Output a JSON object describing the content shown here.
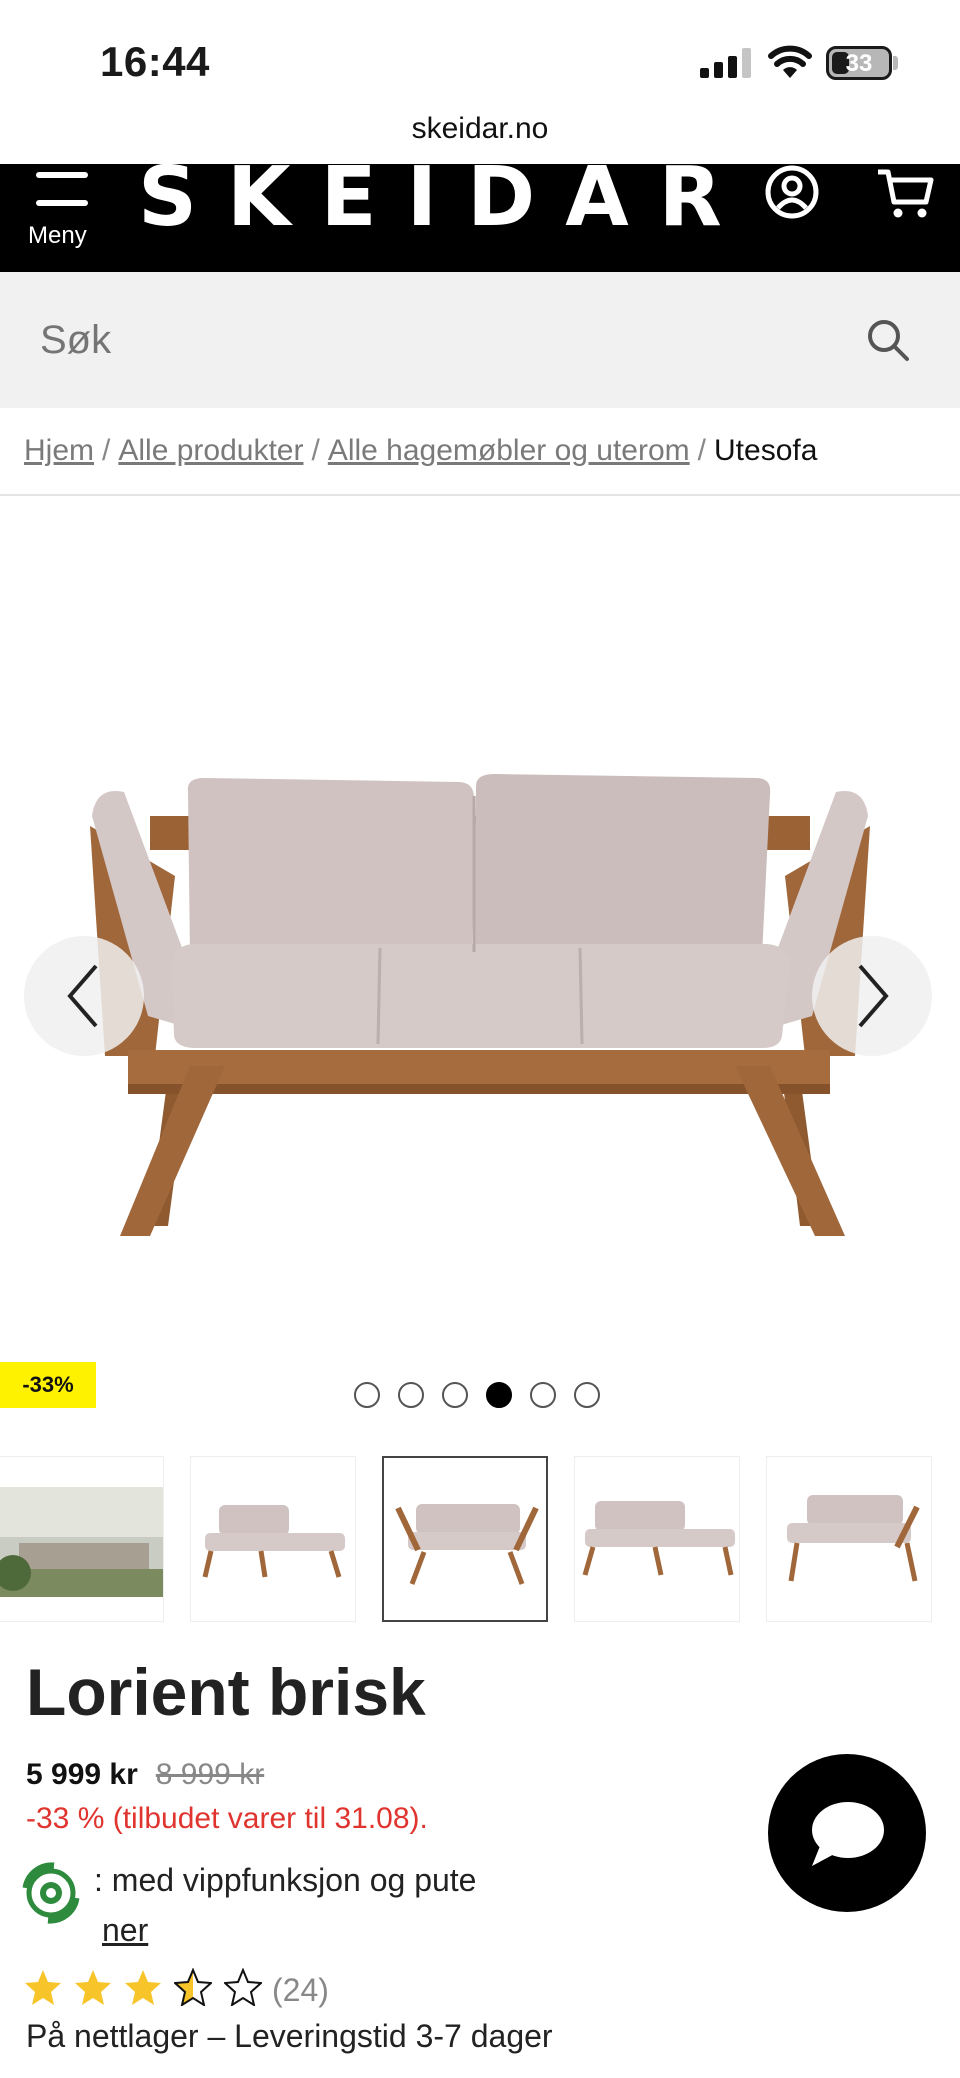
{
  "status_bar": {
    "time": "16:44",
    "battery": "33"
  },
  "browser": {
    "url": "skeidar.no"
  },
  "header": {
    "menu_label": "Meny",
    "logo": "SKEIDAR"
  },
  "search": {
    "placeholder": "Søk"
  },
  "breadcrumb": {
    "items": [
      "Hjem",
      "Alle produkter",
      "Alle hagemøbler og uterom"
    ],
    "current": "Utesofa"
  },
  "gallery": {
    "discount_badge": "-33%",
    "total_dots": 6,
    "active_dot": 4
  },
  "product": {
    "title": "Lorient brisk",
    "price": "5 999 kr",
    "old_price": "8 999 kr",
    "offer": "-33 % (tilbudet varer til 31.08).",
    "description_line1": ": med vippfunksjon og pute",
    "description_line2": "ner",
    "rating": 3.5,
    "review_count": "(24)",
    "stock": "På nettlager – Leveringstid 3-7 dager"
  },
  "colors": {
    "header_bg": "#000000",
    "badge_bg": "#fff200",
    "offer_red": "#e0342f",
    "wood": "#a0673a",
    "cushion": "#d0c3c2",
    "star": "#f7c52a"
  }
}
